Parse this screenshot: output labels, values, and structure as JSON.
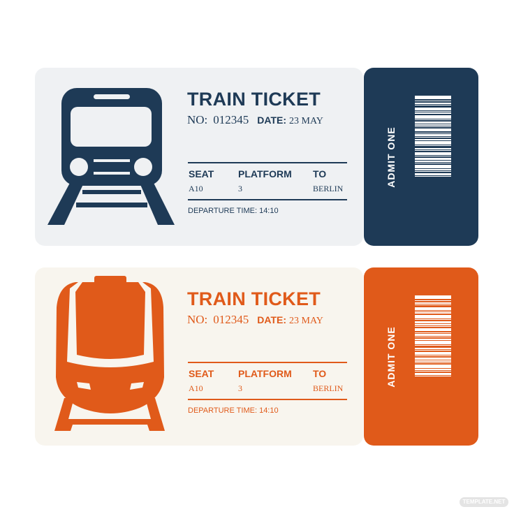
{
  "colors": {
    "navy": "#1e3a56",
    "orange": "#e05a1a",
    "ticket1_bg": "#eff1f3",
    "ticket2_bg": "#f8f5ee"
  },
  "tickets": [
    {
      "theme": "navy",
      "icon": "train-front-icon",
      "title": "TRAIN TICKET",
      "no_label": "NO:",
      "number": "012345",
      "date_label": "DATE:",
      "date": "23 MAY",
      "headers": {
        "seat": "SEAT",
        "platform": "PLATFORM",
        "to": "TO"
      },
      "values": {
        "seat": "A10",
        "platform": "3",
        "to": "BERLIN"
      },
      "departure": "DEPARTURE TIME: 14:10",
      "stub_text": "ADMIT ONE",
      "barcode": "barcode-icon"
    },
    {
      "theme": "orange",
      "icon": "bullet-train-icon",
      "title": "TRAIN TICKET",
      "no_label": "NO:",
      "number": "012345",
      "date_label": "DATE:",
      "date": "23 MAY",
      "headers": {
        "seat": "SEAT",
        "platform": "PLATFORM",
        "to": "TO"
      },
      "values": {
        "seat": "A10",
        "platform": "3",
        "to": "BERLIN"
      },
      "departure": "DEPARTURE TIME: 14:10",
      "stub_text": "ADMIT ONE",
      "barcode": "barcode-icon"
    }
  ],
  "watermark": "TEMPLATE.NET"
}
